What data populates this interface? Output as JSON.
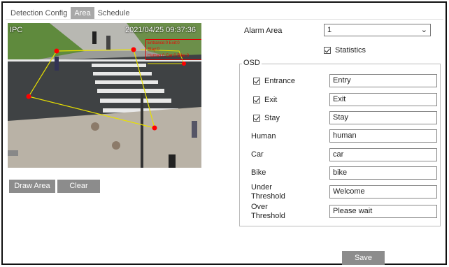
{
  "tabs": [
    {
      "label": "Detection Config"
    },
    {
      "label": "Area"
    },
    {
      "label": "Schedule"
    }
  ],
  "video": {
    "timestamp": "2021/04/25 09:37:36",
    "camera_name": "IPC",
    "stats_lines": [
      "Entrance:0 Exit:0",
      "Stay:0",
      "Human:0 Car:0 Bike:0"
    ]
  },
  "buttons": {
    "draw_area": "Draw Area",
    "clear": "Clear",
    "save": "Save"
  },
  "alarm_area": {
    "label": "Alarm Area",
    "value": "1"
  },
  "statistics": {
    "label": "Statistics",
    "checked": true
  },
  "osd": {
    "legend": "OSD",
    "rows": [
      {
        "label": "Entrance",
        "value": "Entry",
        "checkbox": true
      },
      {
        "label": "Exit",
        "value": "Exit",
        "checkbox": true
      },
      {
        "label": "Stay",
        "value": "Stay",
        "checkbox": true
      },
      {
        "label": "Human",
        "value": "human",
        "checkbox": false
      },
      {
        "label": "Car",
        "value": "car",
        "checkbox": false
      },
      {
        "label": "Bike",
        "value": "bike",
        "checkbox": false
      },
      {
        "label": "Under Threshold",
        "label_lines": [
          "Under",
          "Threshold"
        ],
        "value": "Welcome",
        "checkbox": false
      },
      {
        "label": "Over Threshold",
        "label_lines": [
          "Over",
          "Threshold"
        ],
        "value": "Please wait",
        "checkbox": false
      }
    ]
  },
  "colors": {
    "accent_gray": "#8c8c8c",
    "area_line": "#e8e000",
    "area_point": "#ff0000"
  }
}
